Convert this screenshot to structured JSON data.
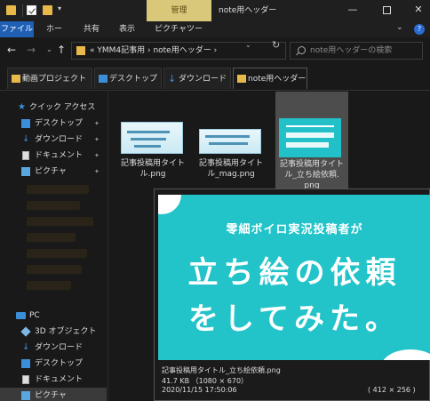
{
  "titlebar": {
    "manage_label": "管理",
    "window_title": "note用ヘッダー",
    "minimize": "—",
    "close": "✕"
  },
  "ribbon": {
    "tabs": [
      "ファイル",
      "ホーム",
      "共有",
      "表示",
      "ピクチャツール"
    ]
  },
  "address": {
    "path": "«  YMM4記事用  ›  note用ヘッダー  ›",
    "search_placeholder": "note用ヘッダーの検索"
  },
  "folder_tabs": [
    {
      "label": "動画プロジェクト",
      "icon": "folder-icon"
    },
    {
      "label": "デスクトップ",
      "icon": "desktop-icon"
    },
    {
      "label": "ダウンロード",
      "icon": "download-icon"
    },
    {
      "label": "note用ヘッダー",
      "icon": "folder-icon",
      "active": true
    }
  ],
  "sidebar": {
    "quick_access": "クイック アクセス",
    "pinned": [
      "デスクトップ",
      "ダウンロード",
      "ドキュメント",
      "ピクチャ"
    ],
    "pc": "PC",
    "pc_items": [
      "3D オブジェクト",
      "ダウンロード",
      "デスクトップ",
      "ドキュメント",
      "ピクチャ"
    ]
  },
  "files": [
    {
      "name": "記事投稿用タイト\nル.png"
    },
    {
      "name": "記事投稿用タイト\nル_mag.png"
    },
    {
      "name": "記事投稿用タイト\nル_立ち絵依頼.\npng",
      "selected": true
    }
  ],
  "preview": {
    "subtitle": "零細ボイロ実況投稿者が",
    "line1": "立ち絵の依頼",
    "line2": "をしてみた。",
    "filename": "記事投稿用タイトル_立ち絵依頼.png",
    "size": "41.7 KB （1080 × 670）",
    "date": "2020/11/15 17:50:06",
    "display_size": "( 412 × 256 )"
  }
}
